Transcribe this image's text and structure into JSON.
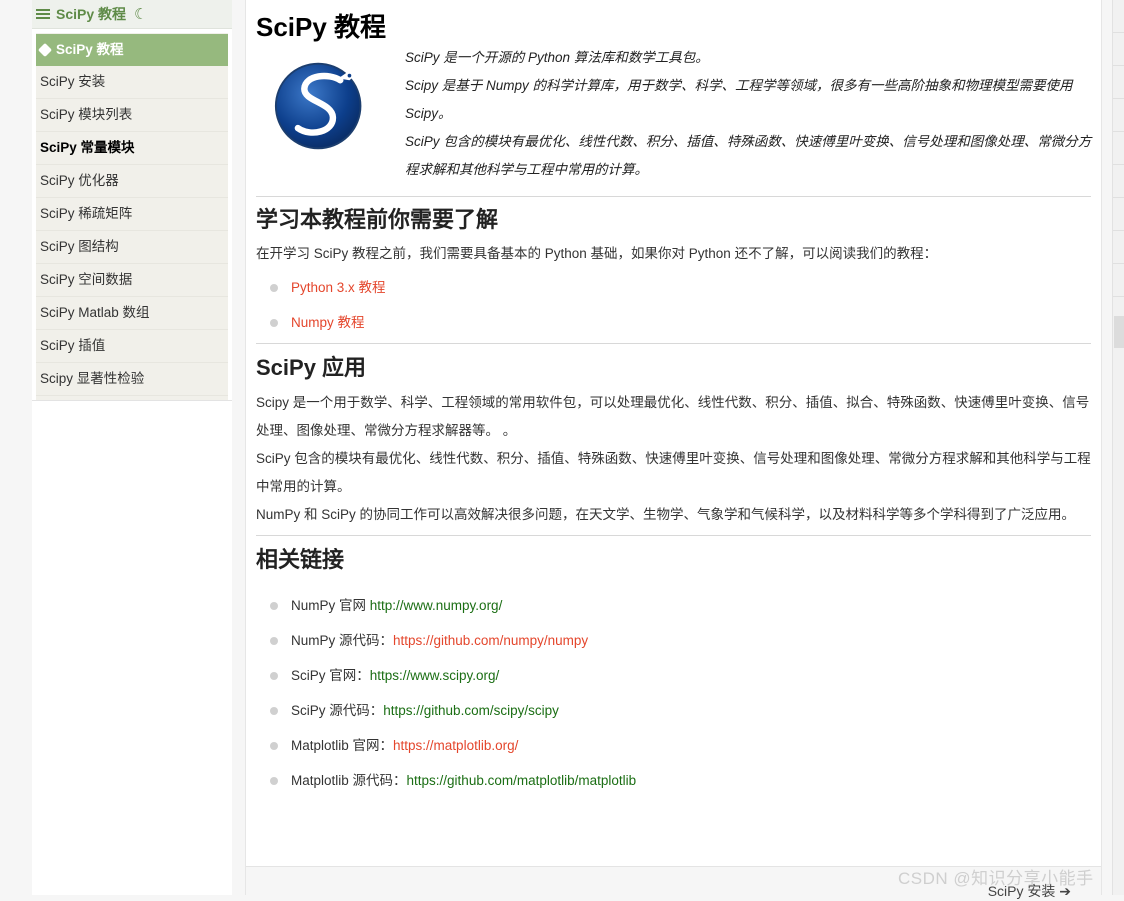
{
  "sidebar": {
    "header_title": "SciPy 教程",
    "items": [
      {
        "label": "SciPy 教程",
        "state": "active"
      },
      {
        "label": "SciPy 安装",
        "state": ""
      },
      {
        "label": "SciPy 模块列表",
        "state": ""
      },
      {
        "label": "SciPy 常量模块",
        "state": "current"
      },
      {
        "label": "SciPy 优化器",
        "state": ""
      },
      {
        "label": "SciPy 稀疏矩阵",
        "state": ""
      },
      {
        "label": "SciPy 图结构",
        "state": ""
      },
      {
        "label": "SciPy 空间数据",
        "state": ""
      },
      {
        "label": "SciPy Matlab 数组",
        "state": ""
      },
      {
        "label": "SciPy 插值",
        "state": ""
      },
      {
        "label": "Scipy 显著性检验",
        "state": ""
      }
    ]
  },
  "main": {
    "title": "SciPy 教程",
    "intro": [
      "SciPy 是一个开源的 Python 算法库和数学工具包。",
      "Scipy 是基于 Numpy 的科学计算库，用于数学、科学、工程学等领域，很多有一些高阶抽象和物理模型需要使用 Scipy。",
      "SciPy 包含的模块有最优化、线性代数、积分、插值、特殊函数、快速傅里叶变换、信号处理和图像处理、常微分方程求解和其他科学与工程中常用的计算。"
    ],
    "prereq": {
      "heading": "学习本教程前你需要了解",
      "text": "在开学习 SciPy 教程之前，我们需要具备基本的 Python 基础，如果你对 Python 还不了解，可以阅读我们的教程：",
      "links": [
        "Python 3.x 教程",
        "Numpy 教程"
      ]
    },
    "apps": {
      "heading": "SciPy 应用",
      "paragraphs": [
        "Scipy 是一个用于数学、科学、工程领域的常用软件包，可以处理最优化、线性代数、积分、插值、拟合、特殊函数、快速傅里叶变换、信号处理、图像处理、常微分方程求解器等。 。",
        "SciPy 包含的模块有最优化、线性代数、积分、插值、特殊函数、快速傅里叶变换、信号处理和图像处理、常微分方程求解和其他科学与工程中常用的计算。",
        "NumPy 和 SciPy 的协同工作可以高效解决很多问题，在天文学、生物学、气象学和气候科学，以及材料科学等多个学科得到了广泛应用。"
      ]
    },
    "links": {
      "heading": "相关链接",
      "items": [
        {
          "label": "NumPy 官网 ",
          "url": "http://www.numpy.org/",
          "color": "green"
        },
        {
          "label": "NumPy 源代码：",
          "url": "https://github.com/numpy/numpy",
          "color": "red"
        },
        {
          "label": "SciPy 官网：",
          "url": "https://www.scipy.org/",
          "color": "green"
        },
        {
          "label": "SciPy 源代码：",
          "url": "https://github.com/scipy/scipy",
          "color": "green"
        },
        {
          "label": "Matplotlib 官网：",
          "url": "https://matplotlib.org/",
          "color": "red"
        },
        {
          "label": "Matplotlib 源代码：",
          "url": "https://github.com/matplotlib/matplotlib",
          "color": "green"
        }
      ]
    },
    "next_label": "SciPy 安装"
  },
  "watermark": "CSDN @知识分享小能手",
  "colors": {
    "accent": "#96b97e",
    "link_red": "#e4462c",
    "link_green": "#1b6e14"
  }
}
